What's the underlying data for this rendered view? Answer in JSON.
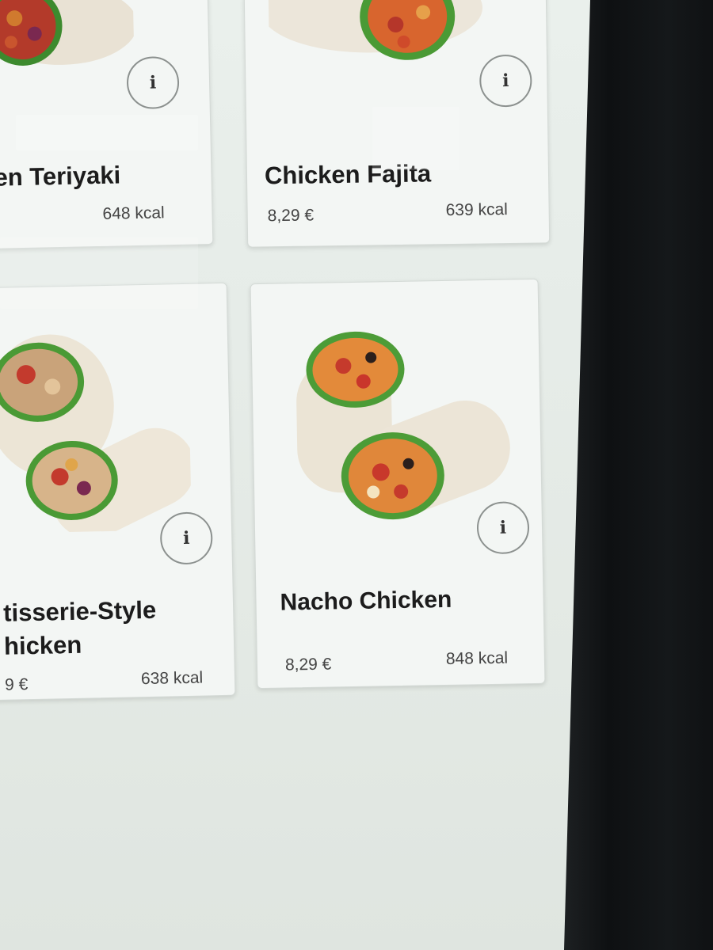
{
  "menu": {
    "items": [
      {
        "title": "en Teriyaki",
        "price": "",
        "kcal": "648 kcal",
        "info_icon": "i"
      },
      {
        "title": "Chicken Fajita",
        "price": "8,29 €",
        "kcal": "639 kcal",
        "info_icon": "i"
      },
      {
        "title_line1": "tisserie-Style",
        "title_line2": "hicken",
        "price": "9 €",
        "kcal": "638 kcal",
        "info_icon": "i"
      },
      {
        "title": "Nacho Chicken",
        "price": "8,29 €",
        "kcal": "848 kcal",
        "info_icon": "i"
      }
    ]
  },
  "colors": {
    "screen_bg": "#e6ece8",
    "card_bg": "#f3f6f4",
    "bezel": "#111315",
    "background_green": "#3f8f3d",
    "background_yellow": "#f4b400"
  },
  "icons": {
    "info": "info-icon",
    "food_image": "wrap-image"
  }
}
